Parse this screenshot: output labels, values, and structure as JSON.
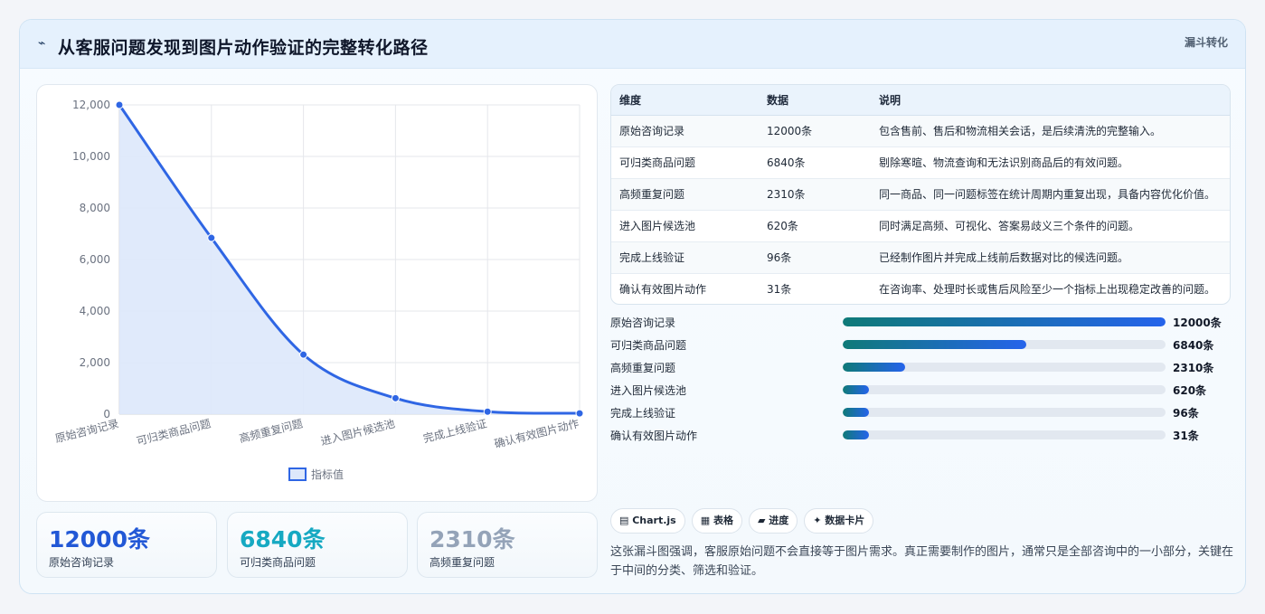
{
  "header": {
    "icon": "⌁",
    "title": "从客服问题发现到图片动作验证的完整转化路径",
    "tag": "漏斗转化"
  },
  "chart_data": {
    "type": "line",
    "categories": [
      "原始咨询记录",
      "可归类商品问题",
      "高频重复问题",
      "进入图片候选池",
      "完成上线验证",
      "确认有效图片动作"
    ],
    "series": [
      {
        "name": "指标值",
        "values": [
          12000,
          6840,
          2310,
          620,
          96,
          31
        ]
      }
    ],
    "ylim": [
      0,
      12000
    ],
    "yticks": [
      "0",
      "2,000",
      "4,000",
      "6,000",
      "8,000",
      "10,000",
      "12,000"
    ],
    "fill": true,
    "grid": true,
    "legend": "bottom",
    "colors": {
      "line": "#2f66e4",
      "fill": "#dde8fb"
    }
  },
  "kpis": [
    {
      "value": "12000条",
      "label": "原始咨询记录",
      "color": "#2258d6"
    },
    {
      "value": "6840条",
      "label": "可归类商品问题",
      "color": "#16a9c2"
    },
    {
      "value": "2310条",
      "label": "高频重复问题",
      "color": "#94a3b8"
    }
  ],
  "table": {
    "headers": [
      "维度",
      "数据",
      "说明"
    ],
    "rows": [
      [
        "原始咨询记录",
        "12000条",
        "包含售前、售后和物流相关会话，是后续清洗的完整输入。"
      ],
      [
        "可归类商品问题",
        "6840条",
        "剔除寒暄、物流查询和无法识别商品后的有效问题。"
      ],
      [
        "高频重复问题",
        "2310条",
        "同一商品、同一问题标签在统计周期内重复出现，具备内容优化价值。"
      ],
      [
        "进入图片候选池",
        "620条",
        "同时满足高频、可视化、答案易歧义三个条件的问题。"
      ],
      [
        "完成上线验证",
        "96条",
        "已经制作图片并完成上线前后数据对比的候选问题。"
      ],
      [
        "确认有效图片动作",
        "31条",
        "在咨询率、处理时长或售后风险至少一个指标上出现稳定改善的问题。"
      ]
    ]
  },
  "progress": [
    {
      "label": "原始咨询记录",
      "value": "12000条",
      "fraction": 1.0
    },
    {
      "label": "可归类商品问题",
      "value": "6840条",
      "fraction": 0.57
    },
    {
      "label": "高频重复问题",
      "value": "2310条",
      "fraction": 0.1925
    },
    {
      "label": "进入图片候选池",
      "value": "620条",
      "fraction": 0.0517
    },
    {
      "label": "完成上线验证",
      "value": "96条",
      "fraction": 0.008
    },
    {
      "label": "确认有效图片动作",
      "value": "31条",
      "fraction": 0.0026
    }
  ],
  "chips": [
    "▤ Chart.js",
    "▦ 表格",
    "▰ 进度",
    "✦ 数据卡片"
  ],
  "note": "这张漏斗图强调，客服原始问题不会直接等于图片需求。真正需要制作的图片，通常只是全部咨询中的一小部分，关键在于中间的分类、筛选和验证。"
}
